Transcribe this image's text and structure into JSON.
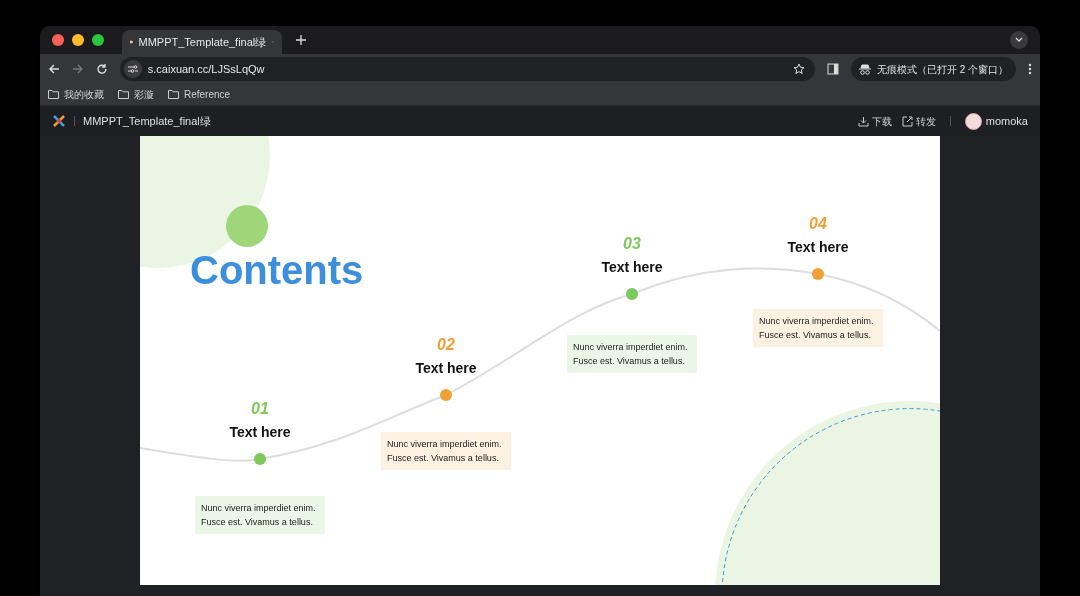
{
  "browser": {
    "tab": {
      "title": "MMPPT_Template_final绿",
      "selected": true
    },
    "url": "s.caixuan.cc/LJSsLqQw",
    "incognito": "无痕模式（已打开 2 个窗口）",
    "bookmarks": [
      "我的收藏",
      "彩漩",
      "Reference"
    ]
  },
  "app_header": {
    "title": "MMPPT_Template_final绿",
    "actions": [
      "下载",
      "转发"
    ],
    "user": "momoka"
  },
  "slide": {
    "title": "Contents",
    "milestones": [
      {
        "number": "01",
        "title": "Text here",
        "text": "Nunc viverra imperdiet enim. Fusce est. Vivamus a tellus.",
        "color": "#7cc95a"
      },
      {
        "number": "02",
        "title": "Text here",
        "text": "Nunc viverra imperdiet enim. Fusce est. Vivamus a tellus.",
        "color": "#f0a035"
      },
      {
        "number": "03",
        "title": "Text here",
        "text": "Nunc viverra imperdiet enim. Fusce est. Vivamus a tellus.",
        "color": "#7cc95a"
      },
      {
        "number": "04",
        "title": "Text here",
        "text": "Nunc viverra imperdiet enim. Fusce est. Vivamus a tellus.",
        "color": "#f0a035"
      }
    ]
  }
}
